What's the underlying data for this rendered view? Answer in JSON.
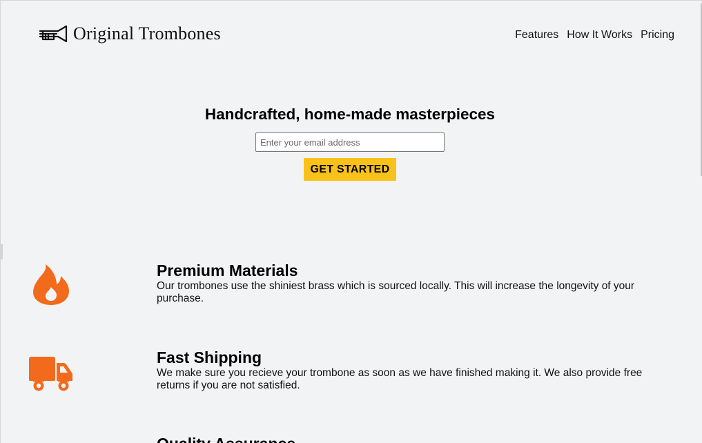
{
  "header": {
    "logo_text": "Original Trombones",
    "nav": [
      {
        "label": "Features"
      },
      {
        "label": "How It Works"
      },
      {
        "label": "Pricing"
      }
    ]
  },
  "hero": {
    "title": "Handcrafted, home-made masterpieces",
    "email_placeholder": "Enter your email address",
    "cta_label": "GET STARTED"
  },
  "features": [
    {
      "icon": "fire-icon",
      "title": "Premium Materials",
      "description": "Our trombones use the shiniest brass which is sourced locally. This will increase the longevity of your purchase."
    },
    {
      "icon": "truck-icon",
      "title": "Fast Shipping",
      "description": "We make sure you recieve your trombone as soon as we have finished making it. We also provide free returns if you are not satisfied."
    },
    {
      "icon": "shield-check-icon",
      "title": "Quality Assurance"
    }
  ],
  "colors": {
    "accent": "#f9c21b",
    "icon_orange": "#f26b1d",
    "background": "#f2f3f5"
  }
}
